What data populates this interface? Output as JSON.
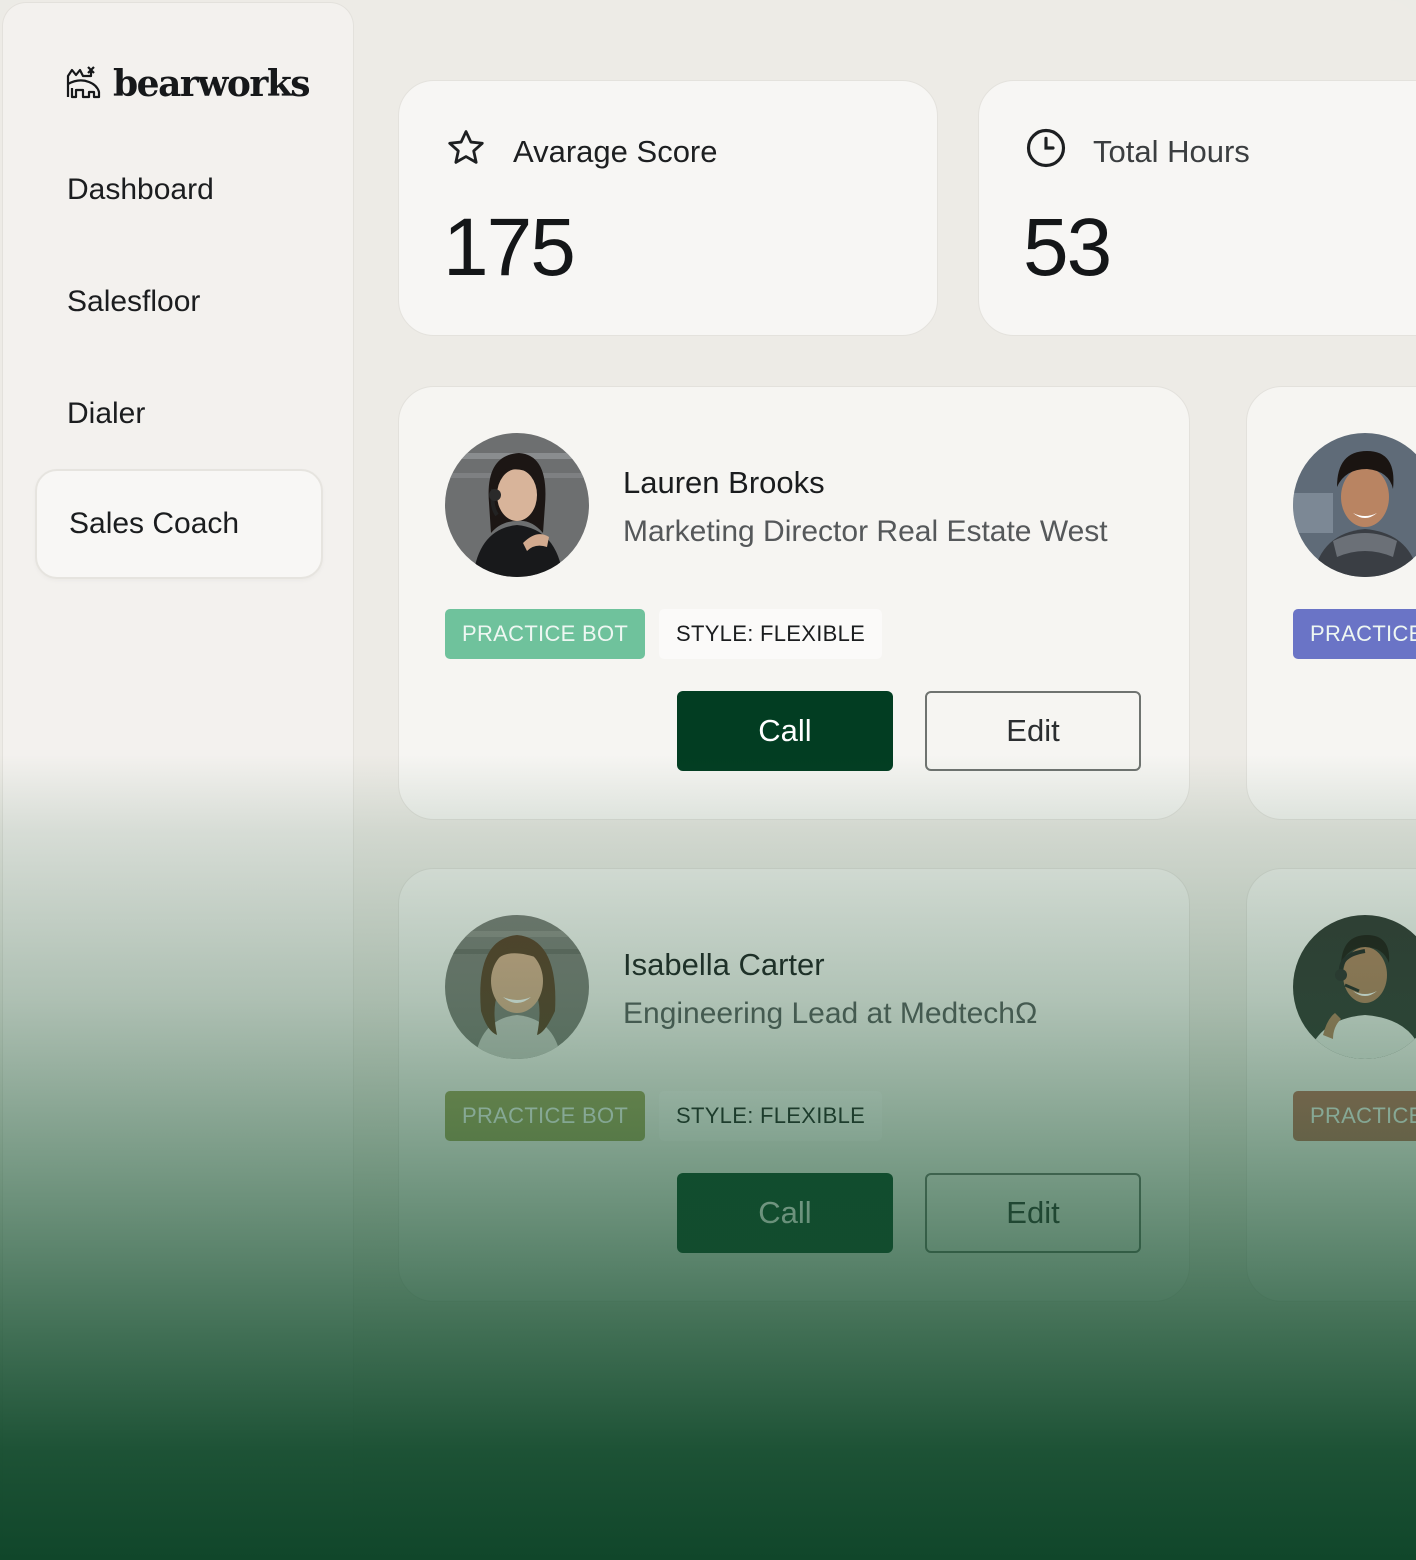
{
  "brand": {
    "name": "bearworks",
    "logo_icon": "bear-icon"
  },
  "sidebar": {
    "items": [
      {
        "label": "Dashboard",
        "active": false
      },
      {
        "label": "Salesfloor",
        "active": false
      },
      {
        "label": "Dialer",
        "active": false
      },
      {
        "label": "Sales Coach",
        "active": true
      }
    ]
  },
  "stats": [
    {
      "icon": "star-icon",
      "label": "Avarage Score",
      "value": "175"
    },
    {
      "icon": "clock-icon",
      "label": "Total Hours",
      "value": "53"
    }
  ],
  "bots": [
    {
      "name": "Lauren Brooks",
      "role": "Marketing Director Real Estate West",
      "tag": "PRACTICE BOT",
      "tag_color": "#6fc29c",
      "style": "STYLE: FLEXIBLE",
      "call_label": "Call",
      "edit_label": "Edit"
    },
    {
      "name": "",
      "role": "",
      "tag": "PRACTICE BOT",
      "tag_color": "#6a74c6",
      "style": "",
      "call_label": "",
      "edit_label": ""
    },
    {
      "name": "Isabella Carter",
      "role": "Engineering Lead at MedtechΩ",
      "tag": "PRACTICE BOT",
      "tag_color": "#9aa05a",
      "style": "STYLE: FLEXIBLE",
      "call_label": "Call",
      "edit_label": "Edit"
    },
    {
      "name": "",
      "role": "",
      "tag": "PRACTICE BOT",
      "tag_color": "#b86d5a",
      "style": "",
      "call_label": "",
      "edit_label": ""
    }
  ],
  "colors": {
    "primary": "#023d22",
    "background_gradient_bottom": "#10462a"
  }
}
